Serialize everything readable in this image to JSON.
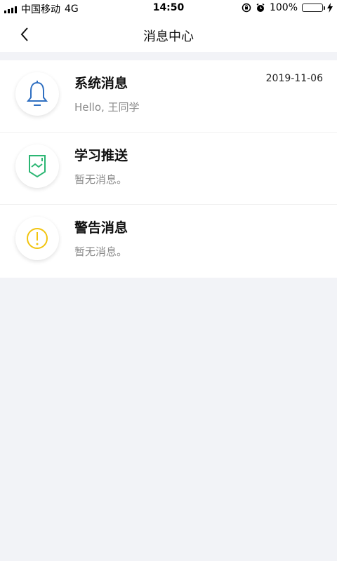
{
  "status_bar": {
    "carrier": "中国移动",
    "network": "4G",
    "time": "14:50",
    "battery": "100%",
    "battery_level": 1.0
  },
  "header": {
    "title": "消息中心"
  },
  "messages": [
    {
      "title": "系统消息",
      "subtitle": "Hello, 王同学",
      "date": "2019-11-06",
      "icon": "bell-icon",
      "color": "#2f6fc1"
    },
    {
      "title": "学习推送",
      "subtitle": "暂无消息。",
      "date": "",
      "icon": "learning-push-icon",
      "color": "#2bb673"
    },
    {
      "title": "警告消息",
      "subtitle": "暂无消息。",
      "date": "",
      "icon": "warning-icon",
      "color": "#f1c40f"
    }
  ]
}
